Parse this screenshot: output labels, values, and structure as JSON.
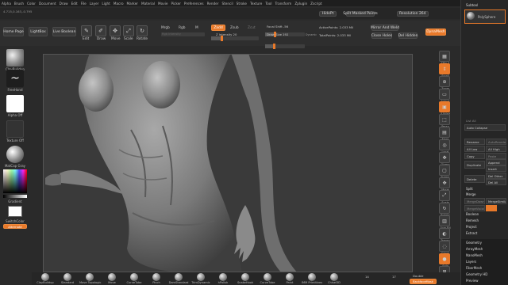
{
  "menu": [
    "Alpha",
    "Brush",
    "Color",
    "Document",
    "Draw",
    "Edit",
    "File",
    "Layer",
    "Light",
    "Macro",
    "Marker",
    "Material",
    "Movie",
    "Picker",
    "Preferences",
    "Render",
    "Stencil",
    "Stroke",
    "Texture",
    "Tool",
    "Transform",
    "Zplugin",
    "Zscript"
  ],
  "status": {
    "coords": "4.715,0.163,-0.795",
    "hide_pt": "HidePt",
    "split_masked": "Split Masked Points",
    "resolution_label": "Resolution 264",
    "subtool": "Subtool"
  },
  "shelf": {
    "home_page": "Home Page",
    "lightbox": "LightBox",
    "live_boolean": "Live Boolean",
    "edit": "Edit",
    "draw": "Draw",
    "move": "Move",
    "scale": "Scale",
    "rotate": "Rotate",
    "mrgb": "Mrgb",
    "rgb": "Rgb",
    "m": "M",
    "zadd": "Zadd",
    "zsub": "Zsub",
    "zcut": "Zcut",
    "rgb_intensity": "Rgb Intensity",
    "z_intensity": "Z Intensity 20",
    "focal_shift": "Focal Shift -56",
    "draw_size": "Draw Size 192",
    "dynamic": "Dynamic",
    "active_points": "ActivePoints: 2.033 Mil",
    "total_points": "TotalPoints: 2.033 Mil",
    "mirror_weld": "Mirror And Weld",
    "close_holes": "Close Holes",
    "del_hidden": "Del Hidden",
    "dynamesh": "DynaMesh"
  },
  "left": {
    "brush": "ClayBuildup",
    "stroke": "FreeHand",
    "alpha": "Alpha Off",
    "texture": "Texture Off",
    "material": "MatCap Gray",
    "gradient": "Gradient",
    "switch_color": "SwitchColor",
    "alternate": "Alternate"
  },
  "right_strip": [
    "SPix 3",
    "Scroll",
    "Zoom",
    "Actual",
    "AAHalf",
    "Persp",
    "Floor",
    "Local",
    "Gizmo",
    "Frame",
    "Move",
    "Scale",
    "Rotate",
    "Line Fill PolyF",
    "Transp",
    "Ghost",
    "Solo",
    "Xpose"
  ],
  "right_panel": {
    "subtool_title": "Subtool",
    "polysphere": "PolySphere",
    "list_all": "List All",
    "auto_collapse": "Auto Collapse",
    "rename": "Rename",
    "autoreorder": "AutoReorder",
    "all_low": "All Low",
    "all_high": "All High",
    "copy": "Copy",
    "paste": "Paste",
    "duplicate": "Duplicate",
    "append": "Append",
    "insert": "Insert",
    "delete": "Delete",
    "del_other": "Del Other",
    "del_all": "Del All",
    "split": "Split",
    "merge": "Merge",
    "merge_down": "MergeDown",
    "merge_similar": "MergeSimilar",
    "merge_visible": "MergeVisible",
    "boolean": "Boolean",
    "remesh": "Remesh",
    "project": "Project",
    "extract": "Extract",
    "geometry": "Geometry",
    "arraymesh": "ArrayMesh",
    "nanomesh": "NanoMesh",
    "layers": "Layers",
    "fibermesh": "FiberMesh",
    "geometry_hd": "Geometry HD",
    "preview": "Preview"
  },
  "brushes": [
    "ClayBuildup",
    "Standard",
    "Move Topologic",
    "Move",
    "CurveTube",
    "Pinch",
    "DamStandard",
    "TrimDynamic",
    "hPolish",
    "SnakeHook",
    "CurveTube",
    "Paint",
    "IMM Primitives",
    "Chisel3D"
  ],
  "bottom": {
    "count_a": "14",
    "count_b": "17",
    "double": "Double",
    "backface": "BackfaceMask"
  },
  "colors": {
    "accent": "#e8792a",
    "bg": "#2a2a2a",
    "viewport": "#3a3a3a"
  }
}
